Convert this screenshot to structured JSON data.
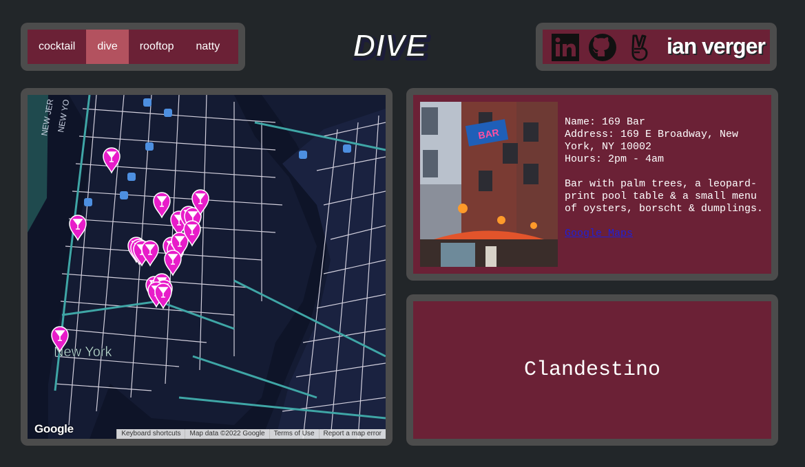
{
  "nav": {
    "items": [
      {
        "label": "cocktail",
        "active": false
      },
      {
        "label": "dive",
        "active": true
      },
      {
        "label": "rooftop",
        "active": false
      },
      {
        "label": "natty",
        "active": false
      }
    ],
    "active_color": "#b3525f"
  },
  "logo": {
    "text": "DIVE"
  },
  "social": {
    "linkedin_icon": "linkedin-icon",
    "github_icon": "github-icon",
    "peace_icon": "peace-hand-icon",
    "author": "ian verger"
  },
  "map": {
    "city_label": "New York",
    "district_labels": [
      "NEW JER",
      "NEW YO"
    ],
    "google_logo": "Google",
    "footer": [
      "Keyboard shortcuts",
      "Map data ©2022 Google",
      "Terms of Use",
      "Report a map error"
    ],
    "marker_color": "#e81cc9",
    "marker_icon": "cocktail-glass-icon"
  },
  "bar": {
    "name_line": "Name: 169 Bar",
    "address_line": "Address: 169 E Broadway, New York, NY 10002",
    "hours_line": "Hours: 2pm - 4am",
    "description": "Bar with palm trees, a leopard-print pool table & a small menu of oysters, borscht & dumplings.",
    "link_text": "Google Maps"
  },
  "next": {
    "name": "Clandestino"
  },
  "colors": {
    "background": "#222629",
    "frame": "#4c4c4c",
    "panel": "#6b2136"
  }
}
